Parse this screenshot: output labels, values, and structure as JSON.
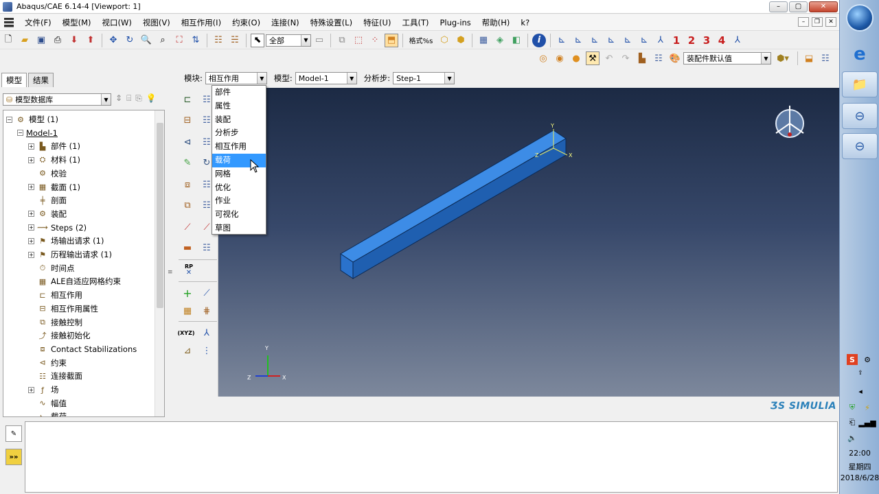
{
  "window": {
    "title": "Abaqus/CAE 6.14-4 [Viewport: 1]"
  },
  "menu": [
    "文件(F)",
    "模型(M)",
    "视口(W)",
    "视图(V)",
    "相互作用(I)",
    "约束(O)",
    "连接(N)",
    "特殊设置(L)",
    "特征(U)",
    "工具(T)",
    "Plug-ins",
    "帮助(H)",
    "k?"
  ],
  "toolbar": {
    "selection_filter": "全部",
    "step_label": "格式%s",
    "view_numbers": [
      "1",
      "2",
      "3",
      "4"
    ],
    "instance_combo": "装配件默认值"
  },
  "left_panel": {
    "tabs": [
      "模型",
      "结果"
    ],
    "tree_combo": "模型数据库",
    "tree": [
      {
        "label": "模型 (1)",
        "indent": 0,
        "exp": "−",
        "icon": "model-icon"
      },
      {
        "label": "Model-1",
        "indent": 1,
        "exp": "−",
        "icon": ""
      },
      {
        "label": "部件 (1)",
        "indent": 2,
        "exp": "+",
        "icon": "part-icon"
      },
      {
        "label": "材料 (1)",
        "indent": 2,
        "exp": "+",
        "icon": "material-icon"
      },
      {
        "label": "校验",
        "indent": 2,
        "exp": "",
        "icon": "calibration-icon"
      },
      {
        "label": "截面 (1)",
        "indent": 2,
        "exp": "+",
        "icon": "section-icon"
      },
      {
        "label": "剖面",
        "indent": 2,
        "exp": "",
        "icon": "profile-icon"
      },
      {
        "label": "装配",
        "indent": 2,
        "exp": "+",
        "icon": "assembly-icon"
      },
      {
        "label": "Steps (2)",
        "indent": 2,
        "exp": "+",
        "icon": "steps-icon"
      },
      {
        "label": "场输出请求 (1)",
        "indent": 2,
        "exp": "+",
        "icon": "field-output-icon"
      },
      {
        "label": "历程输出请求 (1)",
        "indent": 2,
        "exp": "+",
        "icon": "history-output-icon"
      },
      {
        "label": "时间点",
        "indent": 2,
        "exp": "",
        "icon": "time-points-icon"
      },
      {
        "label": "ALE自适应网格约束",
        "indent": 2,
        "exp": "",
        "icon": "ale-icon"
      },
      {
        "label": "相互作用",
        "indent": 2,
        "exp": "",
        "icon": "interaction-icon"
      },
      {
        "label": "相互作用属性",
        "indent": 2,
        "exp": "",
        "icon": "interaction-property-icon"
      },
      {
        "label": "接触控制",
        "indent": 2,
        "exp": "",
        "icon": "contact-control-icon"
      },
      {
        "label": "接触初始化",
        "indent": 2,
        "exp": "",
        "icon": "contact-init-icon"
      },
      {
        "label": "Contact Stabilizations",
        "indent": 2,
        "exp": "",
        "icon": "contact-stabilization-icon"
      },
      {
        "label": "约束",
        "indent": 2,
        "exp": "",
        "icon": "constraint-icon"
      },
      {
        "label": "连接截面",
        "indent": 2,
        "exp": "",
        "icon": "connector-section-icon"
      },
      {
        "label": "场",
        "indent": 2,
        "exp": "+",
        "icon": "field-icon"
      },
      {
        "label": "幅值",
        "indent": 2,
        "exp": "",
        "icon": "amplitude-icon"
      },
      {
        "label": "载荷",
        "indent": 2,
        "exp": "",
        "icon": "load-icon"
      }
    ]
  },
  "module_bar": {
    "module_label": "模块:",
    "module_value": "相互作用",
    "model_label": "模型:",
    "model_value": "Model-1",
    "step_label": "分析步:",
    "step_value": "Step-1"
  },
  "module_dropdown": {
    "items": [
      "部件",
      "属性",
      "装配",
      "分析步",
      "相互作用",
      "载荷",
      "网格",
      "优化",
      "作业",
      "可视化",
      "草图"
    ],
    "selected_index": 5
  },
  "viewport": {
    "rp_label": "RP",
    "xyz_label": "(XYZ)",
    "triad": {
      "x": "X",
      "y": "Y",
      "z": "Z"
    },
    "brand": "SIMULIA"
  },
  "colors": {
    "beam_top": "#3d8ce6",
    "beam_side": "#1f5fb0",
    "beam_end": "#2a72cc",
    "viewport_top": "#1c2a44",
    "viewport_bottom": "#7d889c",
    "selection": "#3399ff"
  },
  "taskbar": {
    "time": "22:00",
    "weekday": "星期四",
    "date": "2018/6/28"
  }
}
